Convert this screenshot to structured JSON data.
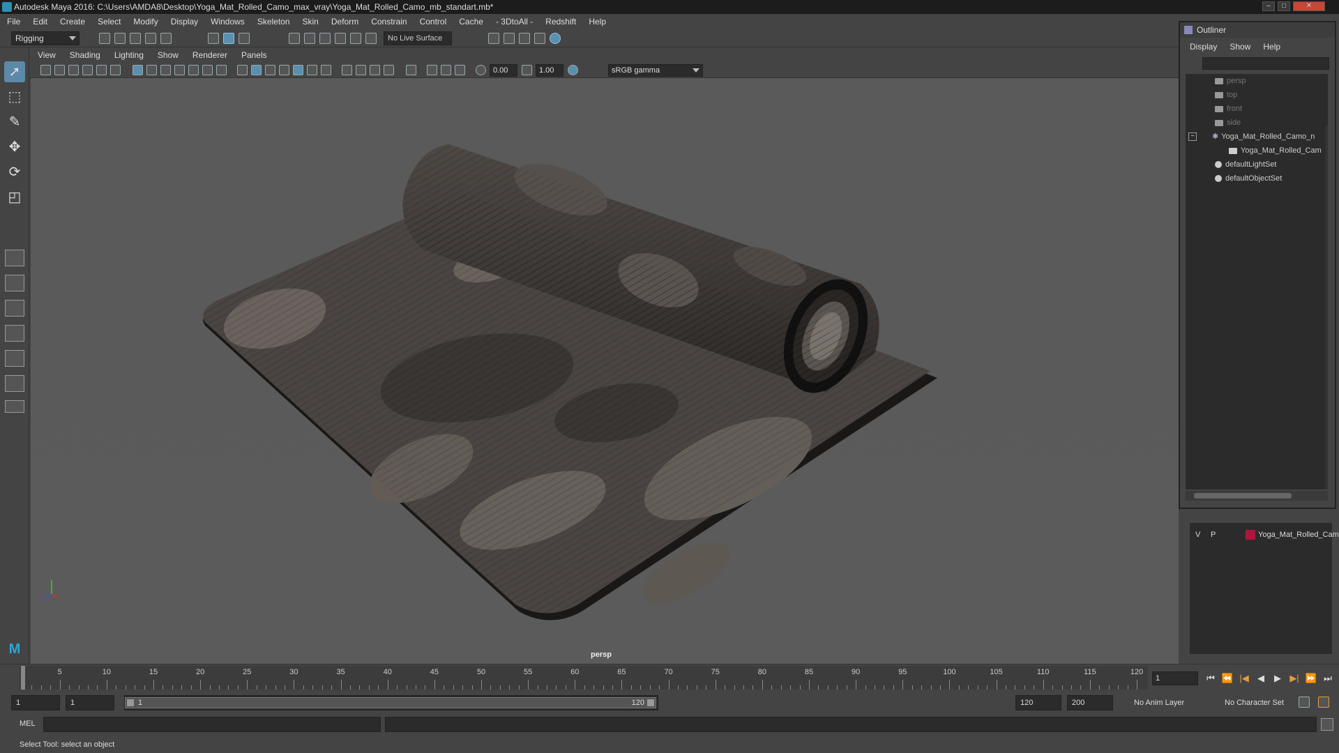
{
  "window": {
    "title": "Autodesk Maya 2016: C:\\Users\\AMDA8\\Desktop\\Yoga_Mat_Rolled_Camo_max_vray\\Yoga_Mat_Rolled_Camo_mb_standart.mb*",
    "minimize": "–",
    "maximize": "□",
    "close": "✕"
  },
  "menubar": [
    "File",
    "Edit",
    "Create",
    "Select",
    "Modify",
    "Display",
    "Windows",
    "Skeleton",
    "Skin",
    "Deform",
    "Constrain",
    "Control",
    "Cache",
    "- 3DtoAll -",
    "Redshift",
    "Help"
  ],
  "statusline": {
    "mode": "Rigging",
    "live_surface": "No Live Surface"
  },
  "panel": {
    "menus": [
      "View",
      "Shading",
      "Lighting",
      "Show",
      "Renderer",
      "Panels"
    ],
    "exposure": "0.00",
    "gamma": "1.00",
    "color_space": "sRGB gamma",
    "camera_label": "persp"
  },
  "outliner": {
    "title": "Outliner",
    "menus": [
      "Display",
      "Show",
      "Help"
    ],
    "items": [
      {
        "label": "persp",
        "dim": true,
        "indent": 1
      },
      {
        "label": "top",
        "dim": true,
        "indent": 1
      },
      {
        "label": "front",
        "dim": true,
        "indent": 1
      },
      {
        "label": "side",
        "dim": true,
        "indent": 1
      },
      {
        "label": "Yoga_Mat_Rolled_Camo_n",
        "dim": false,
        "indent": 1
      },
      {
        "label": "Yoga_Mat_Rolled_Cam",
        "dim": false,
        "indent": 2
      },
      {
        "label": "defaultLightSet",
        "dim": false,
        "indent": 1
      },
      {
        "label": "defaultObjectSet",
        "dim": false,
        "indent": 1
      }
    ]
  },
  "layers": {
    "rows": [
      {
        "v": "V",
        "p": "P",
        "name": "Yoga_Mat_Rolled_Cam",
        "color": "#b0163c"
      }
    ]
  },
  "timeline": {
    "start": 1,
    "end": 120,
    "ticks": [
      5,
      10,
      15,
      20,
      25,
      30,
      35,
      40,
      45,
      50,
      55,
      60,
      65,
      70,
      75,
      80,
      85,
      90,
      95,
      100,
      105,
      110,
      115,
      120
    ],
    "current_frame_field": "1",
    "playback_icons": [
      "⏮",
      "⏪",
      "|◀",
      "◀",
      "▶",
      "▶|",
      "⏩",
      "⏭"
    ]
  },
  "range": {
    "start_field": "1",
    "current_field": "1",
    "range_low": "1",
    "range_high": "120",
    "end_field": "120",
    "max_field": "200",
    "anim_layer": "No Anim Layer",
    "character_set": "No Character Set"
  },
  "cmdline": {
    "label": "MEL"
  },
  "helpline": {
    "text": "Select Tool: select an object"
  }
}
